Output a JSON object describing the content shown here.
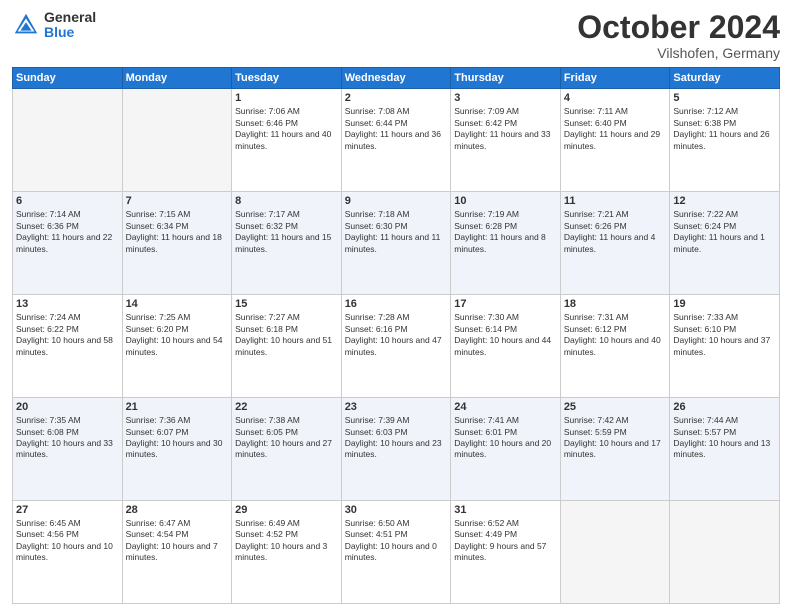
{
  "header": {
    "logo_general": "General",
    "logo_blue": "Blue",
    "month_title": "October 2024",
    "location": "Vilshofen, Germany"
  },
  "weekdays": [
    "Sunday",
    "Monday",
    "Tuesday",
    "Wednesday",
    "Thursday",
    "Friday",
    "Saturday"
  ],
  "weeks": [
    [
      {
        "day": null,
        "sunrise": null,
        "sunset": null,
        "daylight": null
      },
      {
        "day": null,
        "sunrise": null,
        "sunset": null,
        "daylight": null
      },
      {
        "day": "1",
        "sunrise": "Sunrise: 7:06 AM",
        "sunset": "Sunset: 6:46 PM",
        "daylight": "Daylight: 11 hours and 40 minutes."
      },
      {
        "day": "2",
        "sunrise": "Sunrise: 7:08 AM",
        "sunset": "Sunset: 6:44 PM",
        "daylight": "Daylight: 11 hours and 36 minutes."
      },
      {
        "day": "3",
        "sunrise": "Sunrise: 7:09 AM",
        "sunset": "Sunset: 6:42 PM",
        "daylight": "Daylight: 11 hours and 33 minutes."
      },
      {
        "day": "4",
        "sunrise": "Sunrise: 7:11 AM",
        "sunset": "Sunset: 6:40 PM",
        "daylight": "Daylight: 11 hours and 29 minutes."
      },
      {
        "day": "5",
        "sunrise": "Sunrise: 7:12 AM",
        "sunset": "Sunset: 6:38 PM",
        "daylight": "Daylight: 11 hours and 26 minutes."
      }
    ],
    [
      {
        "day": "6",
        "sunrise": "Sunrise: 7:14 AM",
        "sunset": "Sunset: 6:36 PM",
        "daylight": "Daylight: 11 hours and 22 minutes."
      },
      {
        "day": "7",
        "sunrise": "Sunrise: 7:15 AM",
        "sunset": "Sunset: 6:34 PM",
        "daylight": "Daylight: 11 hours and 18 minutes."
      },
      {
        "day": "8",
        "sunrise": "Sunrise: 7:17 AM",
        "sunset": "Sunset: 6:32 PM",
        "daylight": "Daylight: 11 hours and 15 minutes."
      },
      {
        "day": "9",
        "sunrise": "Sunrise: 7:18 AM",
        "sunset": "Sunset: 6:30 PM",
        "daylight": "Daylight: 11 hours and 11 minutes."
      },
      {
        "day": "10",
        "sunrise": "Sunrise: 7:19 AM",
        "sunset": "Sunset: 6:28 PM",
        "daylight": "Daylight: 11 hours and 8 minutes."
      },
      {
        "day": "11",
        "sunrise": "Sunrise: 7:21 AM",
        "sunset": "Sunset: 6:26 PM",
        "daylight": "Daylight: 11 hours and 4 minutes."
      },
      {
        "day": "12",
        "sunrise": "Sunrise: 7:22 AM",
        "sunset": "Sunset: 6:24 PM",
        "daylight": "Daylight: 11 hours and 1 minute."
      }
    ],
    [
      {
        "day": "13",
        "sunrise": "Sunrise: 7:24 AM",
        "sunset": "Sunset: 6:22 PM",
        "daylight": "Daylight: 10 hours and 58 minutes."
      },
      {
        "day": "14",
        "sunrise": "Sunrise: 7:25 AM",
        "sunset": "Sunset: 6:20 PM",
        "daylight": "Daylight: 10 hours and 54 minutes."
      },
      {
        "day": "15",
        "sunrise": "Sunrise: 7:27 AM",
        "sunset": "Sunset: 6:18 PM",
        "daylight": "Daylight: 10 hours and 51 minutes."
      },
      {
        "day": "16",
        "sunrise": "Sunrise: 7:28 AM",
        "sunset": "Sunset: 6:16 PM",
        "daylight": "Daylight: 10 hours and 47 minutes."
      },
      {
        "day": "17",
        "sunrise": "Sunrise: 7:30 AM",
        "sunset": "Sunset: 6:14 PM",
        "daylight": "Daylight: 10 hours and 44 minutes."
      },
      {
        "day": "18",
        "sunrise": "Sunrise: 7:31 AM",
        "sunset": "Sunset: 6:12 PM",
        "daylight": "Daylight: 10 hours and 40 minutes."
      },
      {
        "day": "19",
        "sunrise": "Sunrise: 7:33 AM",
        "sunset": "Sunset: 6:10 PM",
        "daylight": "Daylight: 10 hours and 37 minutes."
      }
    ],
    [
      {
        "day": "20",
        "sunrise": "Sunrise: 7:35 AM",
        "sunset": "Sunset: 6:08 PM",
        "daylight": "Daylight: 10 hours and 33 minutes."
      },
      {
        "day": "21",
        "sunrise": "Sunrise: 7:36 AM",
        "sunset": "Sunset: 6:07 PM",
        "daylight": "Daylight: 10 hours and 30 minutes."
      },
      {
        "day": "22",
        "sunrise": "Sunrise: 7:38 AM",
        "sunset": "Sunset: 6:05 PM",
        "daylight": "Daylight: 10 hours and 27 minutes."
      },
      {
        "day": "23",
        "sunrise": "Sunrise: 7:39 AM",
        "sunset": "Sunset: 6:03 PM",
        "daylight": "Daylight: 10 hours and 23 minutes."
      },
      {
        "day": "24",
        "sunrise": "Sunrise: 7:41 AM",
        "sunset": "Sunset: 6:01 PM",
        "daylight": "Daylight: 10 hours and 20 minutes."
      },
      {
        "day": "25",
        "sunrise": "Sunrise: 7:42 AM",
        "sunset": "Sunset: 5:59 PM",
        "daylight": "Daylight: 10 hours and 17 minutes."
      },
      {
        "day": "26",
        "sunrise": "Sunrise: 7:44 AM",
        "sunset": "Sunset: 5:57 PM",
        "daylight": "Daylight: 10 hours and 13 minutes."
      }
    ],
    [
      {
        "day": "27",
        "sunrise": "Sunrise: 6:45 AM",
        "sunset": "Sunset: 4:56 PM",
        "daylight": "Daylight: 10 hours and 10 minutes."
      },
      {
        "day": "28",
        "sunrise": "Sunrise: 6:47 AM",
        "sunset": "Sunset: 4:54 PM",
        "daylight": "Daylight: 10 hours and 7 minutes."
      },
      {
        "day": "29",
        "sunrise": "Sunrise: 6:49 AM",
        "sunset": "Sunset: 4:52 PM",
        "daylight": "Daylight: 10 hours and 3 minutes."
      },
      {
        "day": "30",
        "sunrise": "Sunrise: 6:50 AM",
        "sunset": "Sunset: 4:51 PM",
        "daylight": "Daylight: 10 hours and 0 minutes."
      },
      {
        "day": "31",
        "sunrise": "Sunrise: 6:52 AM",
        "sunset": "Sunset: 4:49 PM",
        "daylight": "Daylight: 9 hours and 57 minutes."
      },
      {
        "day": null,
        "sunrise": null,
        "sunset": null,
        "daylight": null
      },
      {
        "day": null,
        "sunrise": null,
        "sunset": null,
        "daylight": null
      }
    ]
  ]
}
